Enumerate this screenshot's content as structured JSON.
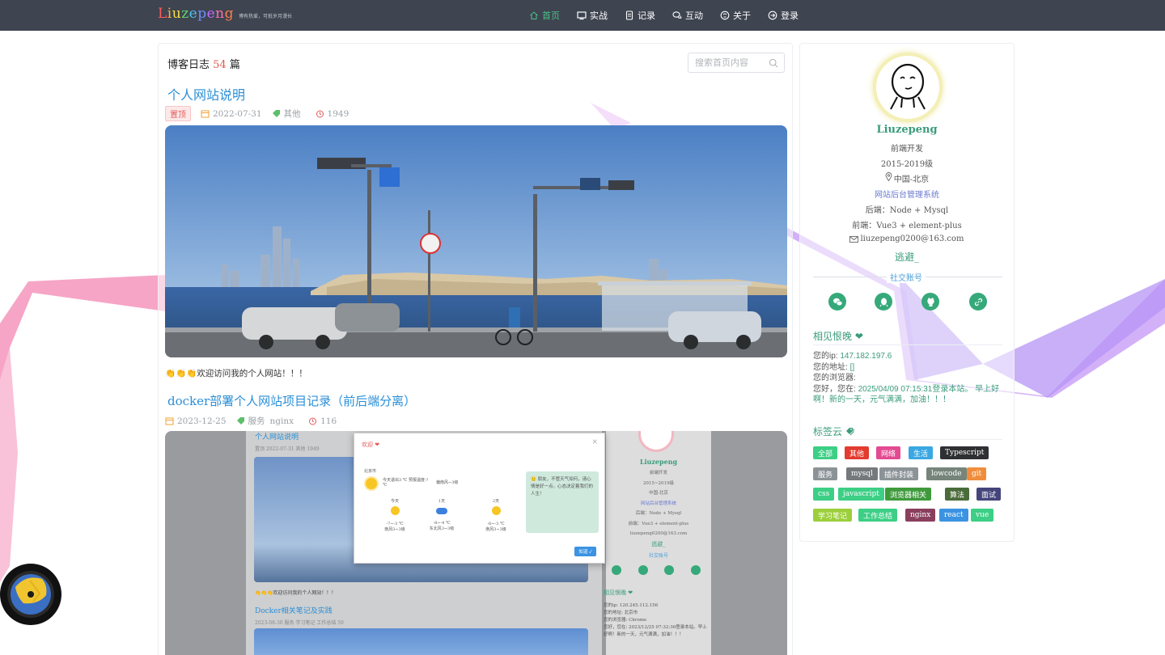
{
  "header": {
    "logo": [
      "L",
      "i",
      "u",
      "z",
      "e",
      "p",
      "e",
      "n",
      "g"
    ],
    "slogan": "博有热爱，可抵岁月漫长",
    "nav": [
      {
        "label": "首页",
        "icon": "home-icon",
        "active": true
      },
      {
        "label": "实战",
        "icon": "monitor-icon",
        "active": false
      },
      {
        "label": "记录",
        "icon": "document-icon",
        "active": false
      },
      {
        "label": "互动",
        "icon": "chat-icon",
        "active": false
      },
      {
        "label": "关于",
        "icon": "info-icon",
        "active": false
      },
      {
        "label": "登录",
        "icon": "login-icon",
        "active": false
      }
    ]
  },
  "main": {
    "title_prefix": "博客日志",
    "post_count": "54",
    "title_suffix": "篇",
    "search_placeholder": "搜索首页内容",
    "posts": [
      {
        "title": "个人网站说明",
        "pin": "置顶",
        "date": "2022-07-31",
        "tags": [
          "其他"
        ],
        "views": "1949",
        "excerpt": "👏👏👏欢迎访问我的个人网站！！！"
      },
      {
        "title": "docker部署个人网站项目记录（前后端分离）",
        "date": "2023-12-25",
        "tags": [
          "服务",
          "nginx"
        ],
        "views": "116"
      }
    ]
  },
  "preview": {
    "welcome_title": "欢迎 ❤",
    "city": "北京市",
    "today": "今天退出3 ℃ 预报温度-? ℃",
    "wind": "偏南风~3级",
    "days": [
      {
        "label": "今天",
        "temp": "-7~-3 ℃",
        "wind": "南风3~3级"
      },
      {
        "label": "1天",
        "temp": "-8~-4 ℃",
        "wind": "东北风3~3级"
      },
      {
        "label": "2天",
        "temp": "-6~-3 ℃",
        "wind": "南风3~3级"
      }
    ],
    "note": "🙂 朋友，不管天气如何，请心情是好一点。心态决定着我们的人生！",
    "ok_button": "知道 ✓",
    "post1_title": "个人网站说明",
    "post1_meta": "置顶  2022-07-31  其他  1949",
    "excerpt": "👏👏👏欢迎访问我的个人网站！！！",
    "post2_title": "Docker相关笔记及实践",
    "post2_meta": "2023-08-30  服务  学习笔记  工作总结  59",
    "side_name": "Liuzepeng",
    "side_lines": [
      "前端开发",
      "2015~2019级",
      "中国-北京",
      "网站后台管理系统",
      "后端：Node + Mysql",
      "前端：Vue3 + element-plus",
      "liuzepeng0200@163.com",
      "逃避_"
    ],
    "side_social": "社交账号",
    "side_sec": "相见恨晚 ❤",
    "side_info": [
      "您的ip: 120.245.112.156",
      "您的地址: 北京市",
      "您的浏览器: Chrome",
      "您好，您在: 2023/12/25 07:32:36登录本站。早上好啊！新的一天，元气满满，加油！！！"
    ]
  },
  "sidebar": {
    "name": "Liuzepeng",
    "role": "前端开发",
    "years": "2015-2019级",
    "location": "中国-北京",
    "admin_link": "网站后台管理系统",
    "backend": "后端：Node + Mysql",
    "frontend": "前端：Vue3 + element-plus",
    "email": "liuzepeng0200@163.com",
    "motto": "逃避_",
    "social_title": "社交账号",
    "social": [
      "wechat-icon",
      "qq-icon",
      "github-icon",
      "link-icon"
    ],
    "visitor_title": "相见恨晚 ❤",
    "ip_label": "您的ip: ",
    "ip": "147.182.197.6",
    "addr_label": "您的地址: ",
    "addr": "[]",
    "browser_label": "您的浏览器: ",
    "browser": "",
    "greeting_prefix": "您好，您在: ",
    "greeting_time": "2025/04/09 07:15:31登录本站。 早上好啊！新的一天，元气满满，加油！！！",
    "tags_title": "标签云",
    "tags": [
      {
        "label": "全部",
        "color": "#3ccf85"
      },
      {
        "label": "其他",
        "color": "#e23b2f"
      },
      {
        "label": "网络",
        "color": "#e44a92"
      },
      {
        "label": "生活",
        "color": "#3ba7e2"
      },
      {
        "label": "Typescript",
        "color": "#2f3033"
      },
      {
        "label": "服务",
        "color": "#8c9397"
      },
      {
        "label": "mysql",
        "color": "#75797c"
      },
      {
        "label": "插件封装",
        "color": "#8c9397"
      },
      {
        "label": "lowcode",
        "color": "#76857c"
      },
      {
        "label": "git",
        "color": "#f08d3d"
      },
      {
        "label": "css",
        "color": "#3ccf85"
      },
      {
        "label": "javascript",
        "color": "#3ccf85"
      },
      {
        "label": "浏览器相关",
        "color": "#3f9a3c"
      },
      {
        "label": "算法",
        "color": "#4a6b3a"
      },
      {
        "label": "面试",
        "color": "#44457a"
      },
      {
        "label": "学习笔记",
        "color": "#9ccf3b"
      },
      {
        "label": "工作总结",
        "color": "#3ccf85"
      },
      {
        "label": "nginx",
        "color": "#8a3f5d"
      },
      {
        "label": "react",
        "color": "#3b93e2"
      },
      {
        "label": "vue",
        "color": "#3ccf85"
      }
    ]
  },
  "colors": {
    "accent": "#3a9c7b",
    "link": "#2b8fd6",
    "header_bg": "#3e4450"
  }
}
